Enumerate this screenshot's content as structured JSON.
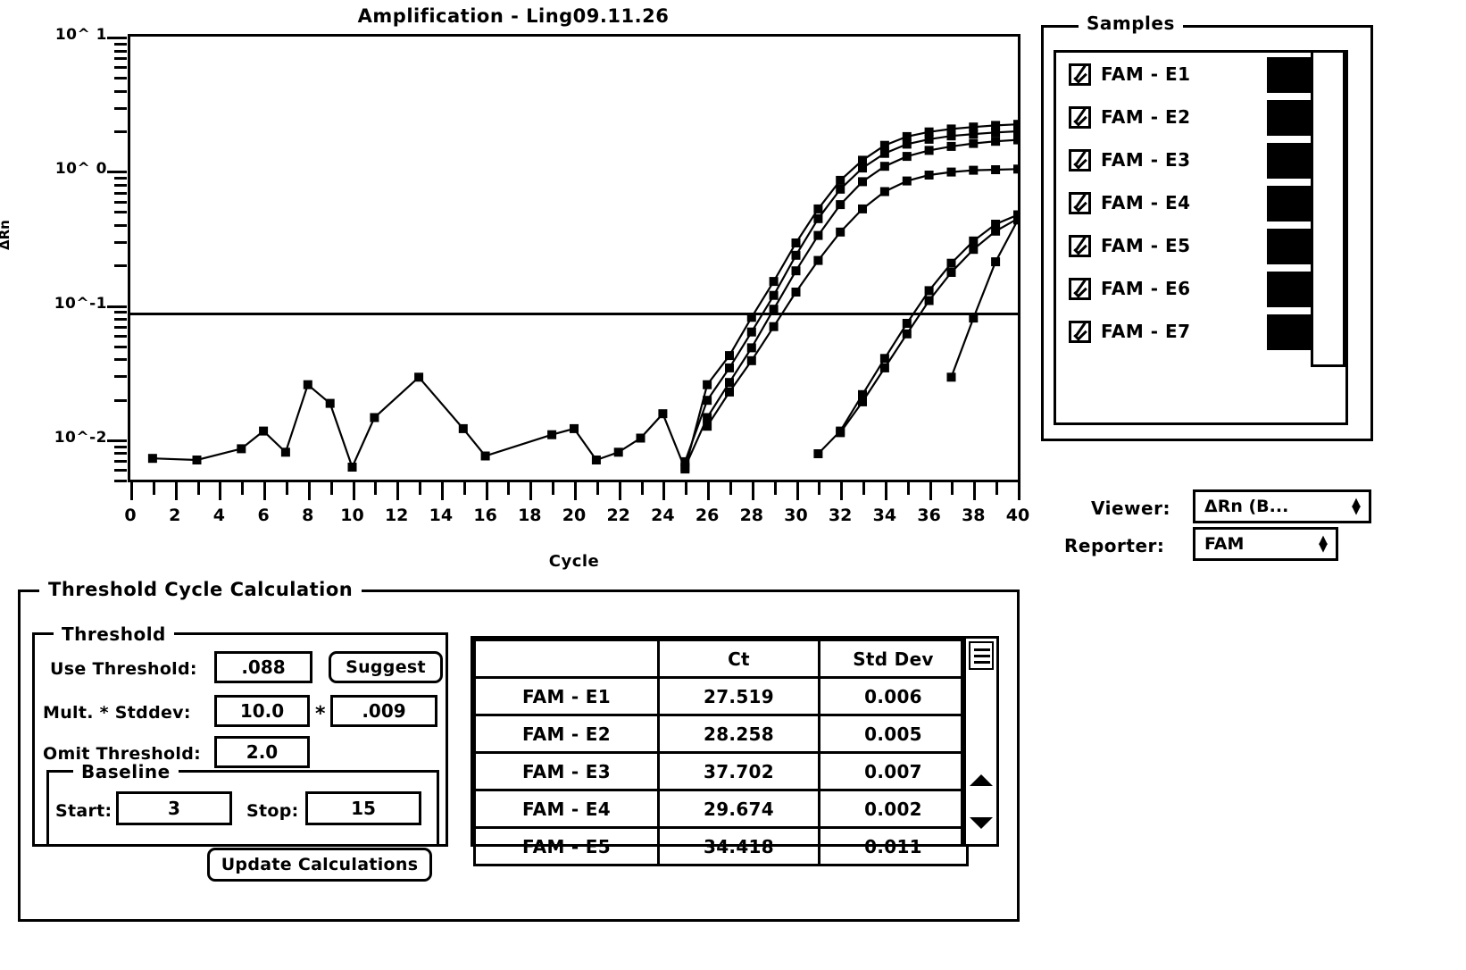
{
  "chart_title": "Amplification -  Ling09.11.26",
  "chart_data": {
    "type": "line",
    "title": "Amplification -  Ling09.11.26",
    "xlabel": "Cycle",
    "ylabel": "ΔRn",
    "yscale": "log",
    "ylim": [
      0.005,
      10
    ],
    "xlim": [
      0,
      40
    ],
    "grid": false,
    "legend": "none",
    "y_tick_labels": [
      "10^ 1",
      "10^ 0",
      "10^-1",
      "10^-2"
    ],
    "y_tick_values": [
      10,
      1,
      0.1,
      0.01
    ],
    "x_tick_labels": [
      "0",
      "2",
      "4",
      "6",
      "8",
      "10",
      "12",
      "14",
      "16",
      "18",
      "20",
      "22",
      "24",
      "26",
      "28",
      "30",
      "32",
      "34",
      "36",
      "38",
      "40"
    ],
    "threshold_line_y": 0.088,
    "series": [
      {
        "name": "FAM - E1",
        "x": [
          1,
          3,
          5,
          6,
          7,
          8,
          9,
          10,
          11,
          13,
          15,
          16,
          19,
          20,
          21,
          22,
          23,
          24,
          25,
          26,
          27,
          28,
          29,
          30,
          31,
          32,
          33,
          34,
          35,
          36,
          37,
          38,
          39,
          40
        ],
        "y": [
          0.0072,
          0.007,
          0.0085,
          0.0115,
          0.008,
          0.0255,
          0.0185,
          0.0062,
          0.0145,
          0.029,
          0.012,
          0.0075,
          0.0108,
          0.012,
          0.007,
          0.008,
          0.0102,
          0.0155,
          0.006,
          0.0255,
          0.042,
          0.081,
          0.15,
          0.29,
          0.52,
          0.85,
          1.2,
          1.55,
          1.8,
          1.95,
          2.05,
          2.12,
          2.18,
          2.22
        ]
      },
      {
        "name": "FAM - E2",
        "x": [
          25,
          26,
          27,
          28,
          29,
          30,
          31,
          32,
          33,
          34,
          35,
          36,
          37,
          38,
          39,
          40
        ],
        "y": [
          0.0068,
          0.0195,
          0.034,
          0.063,
          0.118,
          0.235,
          0.44,
          0.73,
          1.05,
          1.35,
          1.58,
          1.72,
          1.82,
          1.88,
          1.93,
          1.97
        ]
      },
      {
        "name": "FAM - E3",
        "x": [
          25,
          26,
          27,
          28,
          29,
          30,
          31,
          32,
          33,
          34,
          35,
          36,
          37,
          38,
          39,
          40
        ],
        "y": [
          0.0062,
          0.0145,
          0.0265,
          0.048,
          0.093,
          0.18,
          0.33,
          0.56,
          0.83,
          1.08,
          1.28,
          1.42,
          1.52,
          1.6,
          1.66,
          1.7
        ]
      },
      {
        "name": "FAM - E4",
        "x": [
          26,
          27,
          28,
          29,
          30,
          31,
          32,
          33,
          34,
          35,
          36,
          37,
          38,
          39,
          40
        ],
        "y": [
          0.0125,
          0.0225,
          0.0385,
          0.069,
          0.125,
          0.215,
          0.35,
          0.52,
          0.7,
          0.84,
          0.93,
          0.98,
          1.01,
          1.02,
          1.03
        ]
      },
      {
        "name": "FAM - E5",
        "x": [
          31,
          32,
          33,
          34,
          35,
          36,
          37,
          38,
          39,
          40
        ],
        "y": [
          0.0078,
          0.0115,
          0.0215,
          0.04,
          0.073,
          0.128,
          0.205,
          0.3,
          0.4,
          0.47
        ]
      },
      {
        "name": "FAM - E6",
        "x": [
          32,
          33,
          34,
          35,
          36,
          37,
          38,
          39,
          40
        ],
        "y": [
          0.0112,
          0.019,
          0.034,
          0.061,
          0.108,
          0.175,
          0.26,
          0.355,
          0.44
        ]
      },
      {
        "name": "FAM - E7",
        "x": [
          37,
          38,
          39,
          40
        ],
        "y": [
          0.029,
          0.08,
          0.21,
          0.43
        ]
      }
    ]
  },
  "samples": {
    "legend": "Samples",
    "items": [
      {
        "label": "FAM - E1",
        "checked": true
      },
      {
        "label": "FAM - E2",
        "checked": true
      },
      {
        "label": "FAM - E3",
        "checked": true
      },
      {
        "label": "FAM - E4",
        "checked": true
      },
      {
        "label": "FAM - E5",
        "checked": true
      },
      {
        "label": "FAM - E6",
        "checked": true
      },
      {
        "label": "FAM - E7",
        "checked": true
      }
    ]
  },
  "controls": {
    "viewer_label": "Viewer:",
    "viewer_value": "ΔRn (B...",
    "reporter_label": "Reporter:",
    "reporter_value": "FAM"
  },
  "threshold_panel": {
    "legend": "Threshold Cycle Calculation",
    "threshold_legend": "Threshold",
    "use_threshold_label": "Use Threshold:",
    "use_threshold_value": ".088",
    "suggest_label": "Suggest",
    "mult_stddev_label": "Mult. * Stddev:",
    "mult_value": "10.0",
    "times_symbol": "*",
    "stddev_value": ".009",
    "omit_threshold_label": "Omit Threshold:",
    "omit_threshold_value": "2.0",
    "baseline_legend": "Baseline",
    "start_label": "Start:",
    "start_value": "3",
    "stop_label": "Stop:",
    "stop_value": "15",
    "update_label": "Update Calculations"
  },
  "results_table": {
    "headers": [
      "",
      "Ct",
      "Std Dev"
    ],
    "rows": [
      {
        "name": "FAM - E1",
        "ct": "27.519",
        "std_dev": "0.006"
      },
      {
        "name": "FAM - E2",
        "ct": "28.258",
        "std_dev": "0.005"
      },
      {
        "name": "FAM - E3",
        "ct": "37.702",
        "std_dev": "0.007"
      },
      {
        "name": "FAM - E4",
        "ct": "29.674",
        "std_dev": "0.002"
      },
      {
        "name": "FAM - E5",
        "ct": "34.418",
        "std_dev": "0.011"
      }
    ]
  }
}
